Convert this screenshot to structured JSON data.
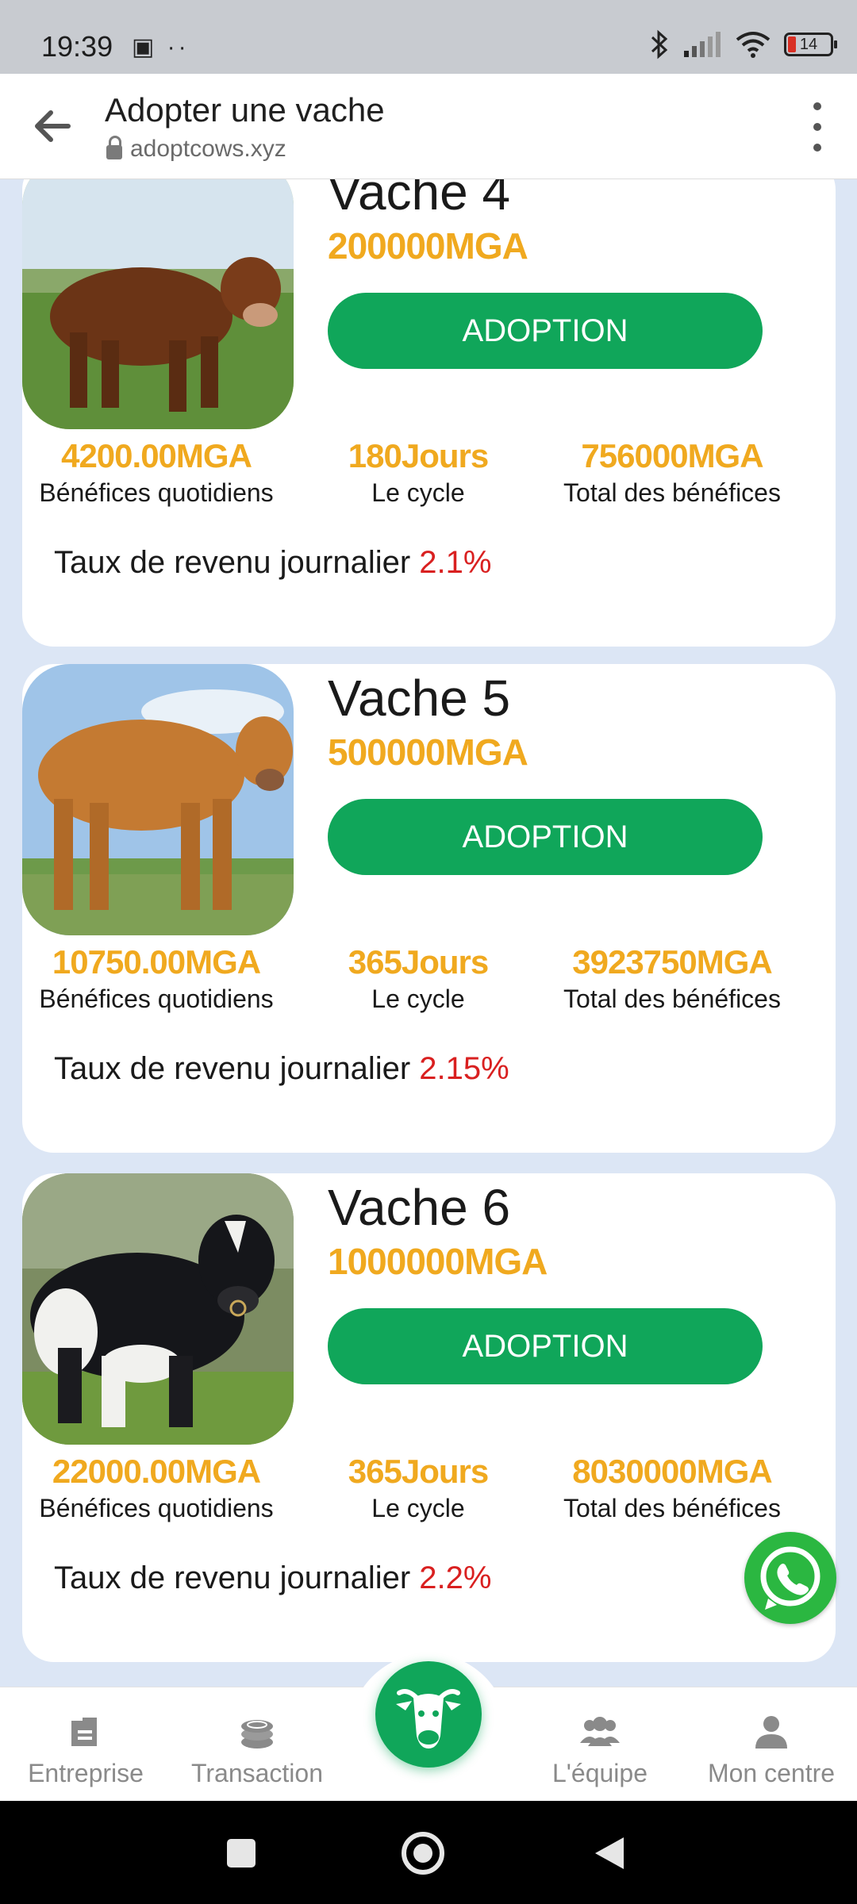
{
  "status_bar": {
    "time": "19:39",
    "left_icons": "▣ ··",
    "battery": "14"
  },
  "browser": {
    "title": "Adopter une vache",
    "url": "adoptcows.xyz"
  },
  "cards": [
    {
      "name": "Vache 4",
      "price": "200000MGA",
      "button": "ADOPTION",
      "daily_profit": "4200.00MGA",
      "daily_profit_label": "Bénéfices quotidiens",
      "cycle": "180Jours",
      "cycle_label": "Le cycle",
      "total": "756000MGA",
      "total_label": "Total des bénéfices",
      "rate_label": "Taux de revenu journalier",
      "rate": "2.1%"
    },
    {
      "name": "Vache 5",
      "price": "500000MGA",
      "button": "ADOPTION",
      "daily_profit": "10750.00MGA",
      "daily_profit_label": "Bénéfices quotidiens",
      "cycle": "365Jours",
      "cycle_label": "Le cycle",
      "total": "3923750MGA",
      "total_label": "Total des bénéfices",
      "rate_label": "Taux de revenu journalier",
      "rate": "2.15%"
    },
    {
      "name": "Vache 6",
      "price": "1000000MGA",
      "button": "ADOPTION",
      "daily_profit": "22000.00MGA",
      "daily_profit_label": "Bénéfices quotidiens",
      "cycle": "365Jours",
      "cycle_label": "Le cycle",
      "total": "8030000MGA",
      "total_label": "Total des bénéfices",
      "rate_label": "Taux de revenu journalier",
      "rate": "2.2%"
    }
  ],
  "tabs": [
    {
      "label": "Entreprise",
      "icon": "document-icon"
    },
    {
      "label": "Transaction",
      "icon": "coins-icon"
    },
    {
      "label": "",
      "icon": "cow-head-icon"
    },
    {
      "label": "L'équipe",
      "icon": "team-icon"
    },
    {
      "label": "Mon centre",
      "icon": "person-icon"
    }
  ],
  "colors": {
    "accent_green": "#10a65a",
    "price_orange": "#f0a91f",
    "rate_red": "#d92020",
    "whatsapp": "#2bb741"
  }
}
